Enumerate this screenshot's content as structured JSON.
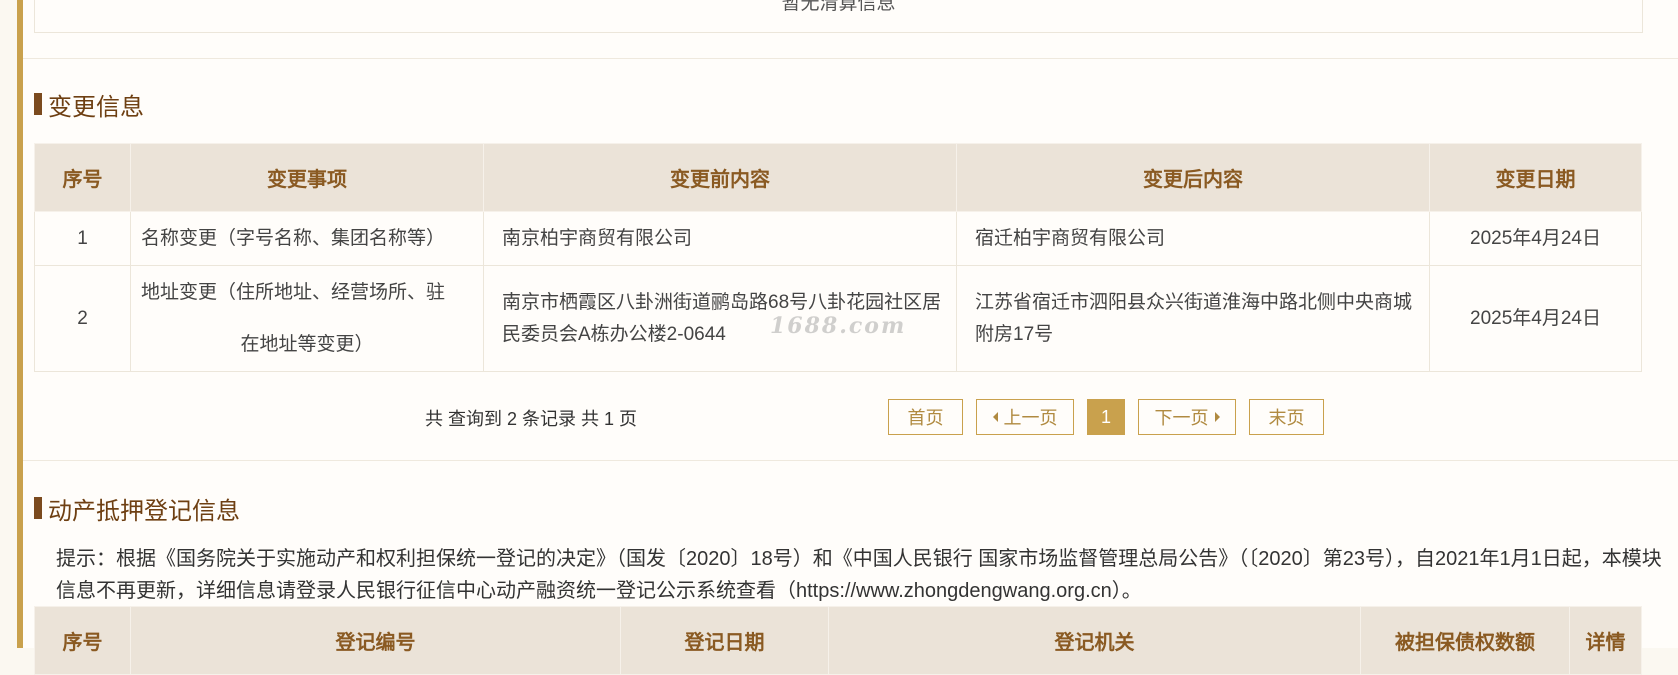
{
  "clearing": {
    "empty_text": "暂无清算信息"
  },
  "changes": {
    "title": "变更信息",
    "headers": [
      "序号",
      "变更事项",
      "变更前内容",
      "变更后内容",
      "变更日期"
    ],
    "rows": [
      {
        "no": "1",
        "item_line1": "名称变更（字号名称、集团名称等）",
        "item_line2": "",
        "before": "南京柏宇商贸有限公司",
        "after": "宿迁柏宇商贸有限公司",
        "date": "2025年4月24日"
      },
      {
        "no": "2",
        "item_line1": "地址变更（住所地址、经营场所、驻",
        "item_line2": "在地址等变更）",
        "before": "南京市栖霞区八卦洲街道鹂岛路68号八卦花园社区居民委员会A栋办公楼2-0644",
        "after": "江苏省宿迁市泗阳县众兴街道淮海中路北侧中央商城附房17号",
        "date": "2025年4月24日"
      }
    ],
    "pager": {
      "summary": "共 查询到 2 条记录 共 1 页",
      "first": "首页",
      "prev": "上一页",
      "current": "1",
      "next": "下一页",
      "last": "末页"
    }
  },
  "watermark": "1688.com",
  "mortgage": {
    "title": "动产抵押登记信息",
    "tip": "提示：根据《国务院关于实施动产和权利担保统一登记的决定》（国发〔2020〕18号）和《中国人民银行 国家市场监督管理总局公告》（〔2020〕第23号），自2021年1月1日起，本模块信息不再更新，详细信息请登录人民银行征信中心动产融资统一登记公示系统查看（https://www.zhongdengwang.org.cn）。",
    "headers": [
      "序号",
      "登记编号",
      "登记日期",
      "登记机关",
      "被担保债权数额",
      "详情"
    ]
  },
  "colors": {
    "accent": "#c9a14d",
    "title": "#6e3f12",
    "header_bg": "#ebe3d8",
    "header_text": "#8a5a22"
  }
}
